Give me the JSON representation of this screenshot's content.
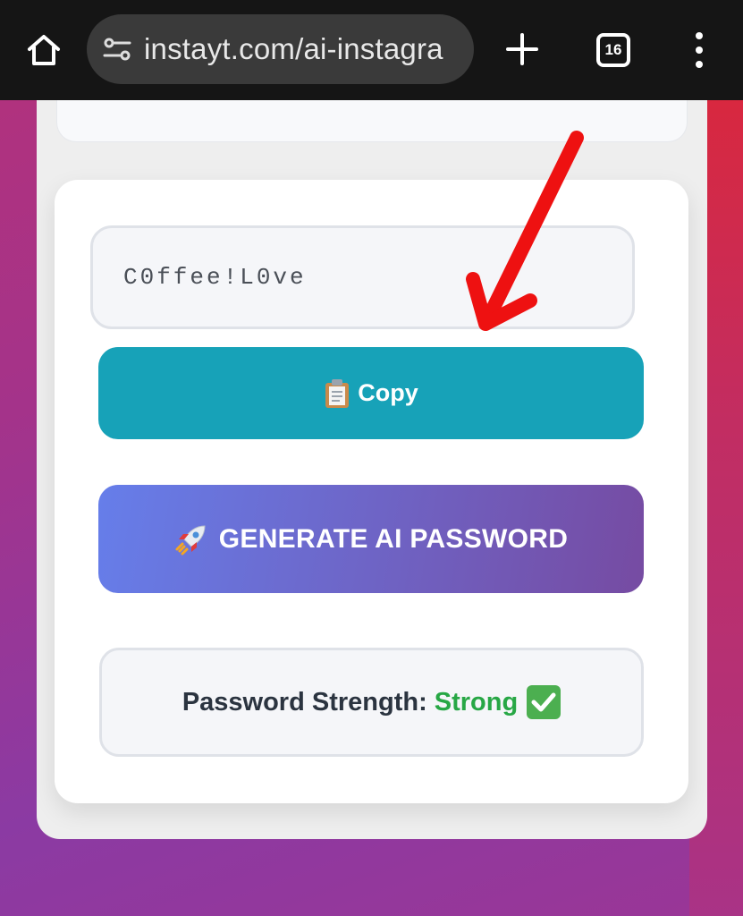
{
  "browser": {
    "url": "instayt.com/ai-instagra",
    "tab_count": "16"
  },
  "password": {
    "value": "C0ffee!L0ve"
  },
  "copy_button": {
    "label": "Copy",
    "icon": "clipboard-icon"
  },
  "generate_button": {
    "label": "GENERATE AI PASSWORD",
    "icon": "rocket-icon"
  },
  "strength": {
    "label": "Password Strength:",
    "value": "Strong",
    "icon": "check-icon",
    "value_color": "#27a745"
  },
  "colors": {
    "copy": "#17a2b8",
    "generate_start": "#667eea",
    "generate_end": "#764ba2",
    "annotation_arrow": "#ee1111"
  }
}
